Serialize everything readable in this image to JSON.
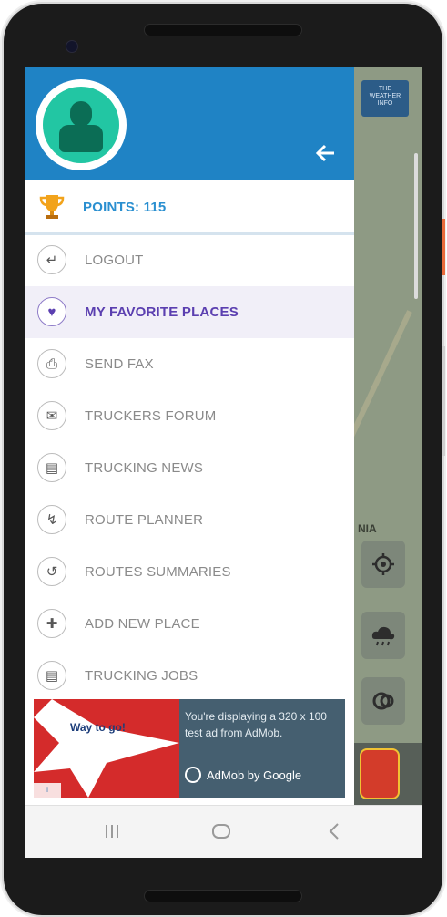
{
  "weather_button": {
    "line1": "THE",
    "line2": "WEATHER",
    "line3": "INFO"
  },
  "map_label": "NIA",
  "points": {
    "label": "POINTS: 115"
  },
  "menu": [
    {
      "label": "LOGOUT",
      "icon": "logout-icon"
    },
    {
      "label": "MY FAVORITE PLACES",
      "icon": "heart-icon",
      "active": true
    },
    {
      "label": "SEND FAX",
      "icon": "printer-icon"
    },
    {
      "label": "TRUCKERS FORUM",
      "icon": "chat-icon"
    },
    {
      "label": "TRUCKING NEWS",
      "icon": "newspaper-icon"
    },
    {
      "label": "ROUTE PLANNER",
      "icon": "route-icon"
    },
    {
      "label": "ROUTES SUMMARIES",
      "icon": "history-icon"
    },
    {
      "label": "ADD NEW PLACE",
      "icon": "add-place-icon"
    },
    {
      "label": "TRUCKING JOBS",
      "icon": "briefcase-icon"
    }
  ],
  "ad": {
    "art_text": "Way to go!",
    "message": "You're displaying a 320 x 100 test ad from AdMob.",
    "brand": "AdMob by Google"
  },
  "colors": {
    "header": "#1f83c5",
    "accent": "#2a8fd0",
    "active": "#5b3fb0",
    "avatar": "#22c6a3"
  }
}
